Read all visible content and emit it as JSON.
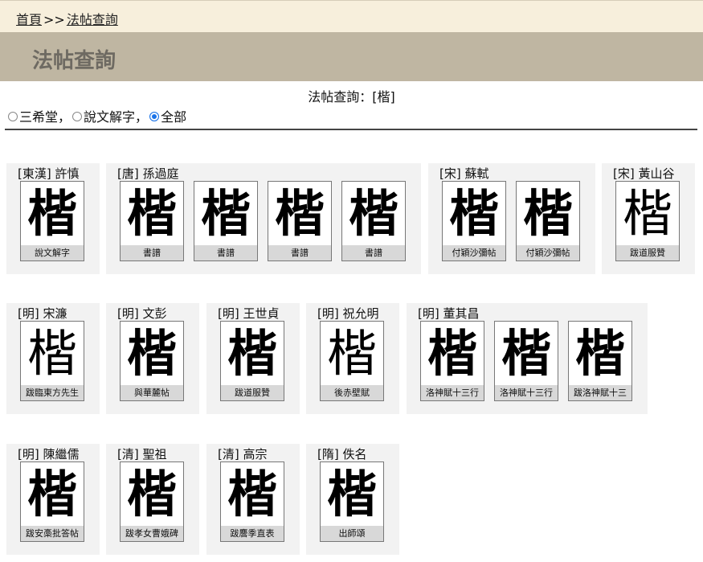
{
  "breadcrumb": {
    "home": "首頁",
    "sep": ">>",
    "current": "法帖查詢"
  },
  "title": "法帖查詢",
  "query": "法帖查詢：[楷]",
  "filters": [
    {
      "label": "三希堂",
      "suffix": "，",
      "checked": false
    },
    {
      "label": "說文解字",
      "suffix": "，",
      "checked": false
    },
    {
      "label": "全部",
      "suffix": "",
      "checked": true
    }
  ],
  "groups": [
    {
      "title": "[東漢] 許慎",
      "items": [
        {
          "glyph": "楷",
          "caption": "說文解字"
        }
      ]
    },
    {
      "title": "[唐] 孫過庭",
      "items": [
        {
          "glyph": "楷",
          "caption": "書譜"
        },
        {
          "glyph": "楷",
          "caption": "書譜"
        },
        {
          "glyph": "楷",
          "caption": "書譜"
        },
        {
          "glyph": "楷",
          "caption": "書譜"
        }
      ]
    },
    {
      "title": "[宋] 蘇軾",
      "items": [
        {
          "glyph": "楷",
          "caption": "付穎沙彌帖"
        },
        {
          "glyph": "楷",
          "caption": "付穎沙彌帖"
        }
      ]
    },
    {
      "title": "[宋] 黃山谷",
      "items": [
        {
          "glyph": "楷",
          "caption": "跋道服贊"
        }
      ]
    },
    {
      "title": "[明] 宋濂",
      "items": [
        {
          "glyph": "楷",
          "caption": "跋臨東方先生"
        }
      ]
    },
    {
      "title": "[明] 文彭",
      "items": [
        {
          "glyph": "楷",
          "caption": "與華麓帖"
        }
      ]
    },
    {
      "title": "[明] 王世貞",
      "items": [
        {
          "glyph": "楷",
          "caption": "跋道服贊"
        }
      ]
    },
    {
      "title": "[明] 祝允明",
      "items": [
        {
          "glyph": "楷",
          "caption": "後赤壁賦"
        }
      ]
    },
    {
      "title": "[明] 董其昌",
      "items": [
        {
          "glyph": "楷",
          "caption": "洛神賦十三行"
        },
        {
          "glyph": "楷",
          "caption": "洛神賦十三行"
        },
        {
          "glyph": "楷",
          "caption": "跋洛神賦十三"
        }
      ]
    },
    {
      "title": "[明] 陳繼儒",
      "items": [
        {
          "glyph": "楷",
          "caption": "跋安槀批答帖"
        }
      ]
    },
    {
      "title": "[清] 聖祖",
      "items": [
        {
          "glyph": "楷",
          "caption": "跋孝女曹娥碑"
        }
      ]
    },
    {
      "title": "[清] 高宗",
      "items": [
        {
          "glyph": "楷",
          "caption": "跋麐季直表"
        }
      ]
    },
    {
      "title": "[隋] 佚名",
      "items": [
        {
          "glyph": "楷",
          "caption": "出師頌"
        }
      ]
    }
  ]
}
